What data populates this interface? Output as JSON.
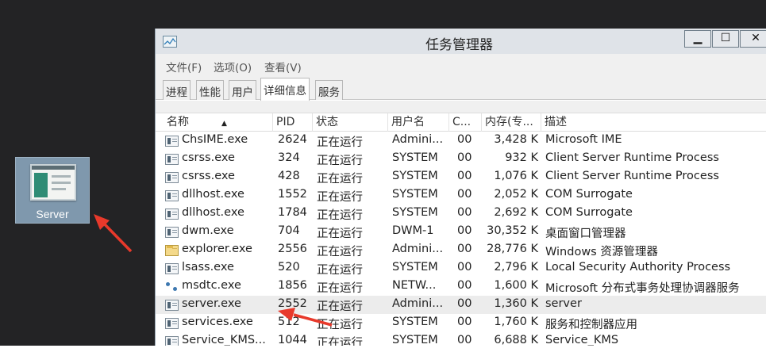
{
  "desktop": {
    "icon": {
      "label": "Server",
      "icon": "app-window-icon"
    }
  },
  "window": {
    "title": "任务管理器",
    "controls": {
      "minimize": "▁",
      "maximize": "☐",
      "close": "✕"
    },
    "menu": [
      "文件(F)",
      "选项(O)",
      "查看(V)"
    ],
    "tabs": [
      {
        "label": "进程",
        "active": false
      },
      {
        "label": "性能",
        "active": false
      },
      {
        "label": "用户",
        "active": false
      },
      {
        "label": "详细信息",
        "active": true
      },
      {
        "label": "服务",
        "active": false
      }
    ],
    "columns": [
      "名称",
      "PID",
      "状态",
      "用户名",
      "C...",
      "内存(专...",
      "描述"
    ],
    "sort_indicator": "▲",
    "rows": [
      {
        "name": "ChsIME.exe",
        "pid": "2624",
        "status": "正在运行",
        "user": "Admini...",
        "cpu": "00",
        "mem": "3,428 K",
        "desc": "Microsoft IME",
        "icon": "exe"
      },
      {
        "name": "csrss.exe",
        "pid": "324",
        "status": "正在运行",
        "user": "SYSTEM",
        "cpu": "00",
        "mem": "932 K",
        "desc": "Client Server Runtime Process",
        "icon": "exe"
      },
      {
        "name": "csrss.exe",
        "pid": "428",
        "status": "正在运行",
        "user": "SYSTEM",
        "cpu": "00",
        "mem": "1,076 K",
        "desc": "Client Server Runtime Process",
        "icon": "exe"
      },
      {
        "name": "dllhost.exe",
        "pid": "1552",
        "status": "正在运行",
        "user": "SYSTEM",
        "cpu": "00",
        "mem": "2,052 K",
        "desc": "COM Surrogate",
        "icon": "exe"
      },
      {
        "name": "dllhost.exe",
        "pid": "1784",
        "status": "正在运行",
        "user": "SYSTEM",
        "cpu": "00",
        "mem": "2,692 K",
        "desc": "COM Surrogate",
        "icon": "exe"
      },
      {
        "name": "dwm.exe",
        "pid": "704",
        "status": "正在运行",
        "user": "DWM-1",
        "cpu": "00",
        "mem": "30,352 K",
        "desc": "桌面窗口管理器",
        "icon": "exe"
      },
      {
        "name": "explorer.exe",
        "pid": "2556",
        "status": "正在运行",
        "user": "Admini...",
        "cpu": "00",
        "mem": "28,776 K",
        "desc": "Windows 资源管理器",
        "icon": "folder"
      },
      {
        "name": "lsass.exe",
        "pid": "520",
        "status": "正在运行",
        "user": "SYSTEM",
        "cpu": "00",
        "mem": "2,796 K",
        "desc": "Local Security Authority Process",
        "icon": "exe"
      },
      {
        "name": "msdtc.exe",
        "pid": "1856",
        "status": "正在运行",
        "user": "NETW...",
        "cpu": "00",
        "mem": "1,600 K",
        "desc": "Microsoft 分布式事务处理协调器服务",
        "icon": "net"
      },
      {
        "name": "server.exe",
        "pid": "2552",
        "status": "正在运行",
        "user": "Admini...",
        "cpu": "00",
        "mem": "1,360 K",
        "desc": "server",
        "icon": "exe",
        "highlighted": true
      },
      {
        "name": "services.exe",
        "pid": "512",
        "status": "正在运行",
        "user": "SYSTEM",
        "cpu": "00",
        "mem": "1,760 K",
        "desc": "服务和控制器应用",
        "icon": "exe"
      },
      {
        "name": "Service_KMS...",
        "pid": "1044",
        "status": "正在运行",
        "user": "SYSTEM",
        "cpu": "00",
        "mem": "6,688 K",
        "desc": "Service_KMS",
        "icon": "exe"
      }
    ]
  },
  "annotations": {
    "arrow_color": "#e8392b"
  }
}
